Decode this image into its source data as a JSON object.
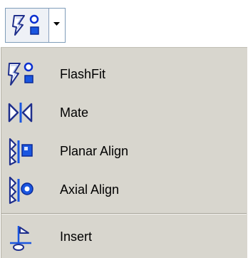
{
  "split_button": {
    "icon": "flashfit-icon",
    "dropdown_icon": "chevron-down-icon"
  },
  "menu": {
    "items": [
      {
        "label": "FlashFit",
        "icon": "flashfit-icon"
      },
      {
        "label": "Mate",
        "icon": "mate-icon"
      },
      {
        "label": "Planar Align",
        "icon": "planar-align-icon"
      },
      {
        "label": "Axial Align",
        "icon": "axial-align-icon"
      },
      {
        "label": "Insert",
        "icon": "insert-icon"
      }
    ]
  },
  "colors": {
    "icon_blue": "#1a56e0",
    "icon_outline": "#2a3a9a",
    "menu_background": "#d8d6ce"
  }
}
